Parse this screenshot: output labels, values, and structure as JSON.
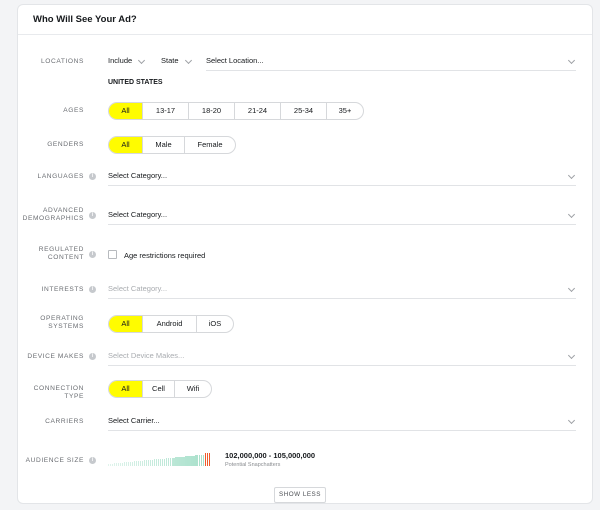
{
  "header": {
    "title": "Who Will See Your Ad?"
  },
  "locations": {
    "label": "LOCATIONS",
    "include_select": "Include",
    "type_select": "State",
    "location_placeholder": "Select Location...",
    "selected_country": "UNITED STATES"
  },
  "ages": {
    "label": "AGES",
    "options": [
      "All",
      "13-17",
      "18-20",
      "21-24",
      "25-34",
      "35+"
    ],
    "selected": "All"
  },
  "genders": {
    "label": "GENDERS",
    "options": [
      "All",
      "Male",
      "Female"
    ],
    "selected": "All"
  },
  "languages": {
    "label": "LANGUAGES",
    "value": "Select Category..."
  },
  "advanced_demographics": {
    "label_line1": "ADVANCED",
    "label_line2": "DEMOGRAPHICS",
    "value": "Select Category..."
  },
  "regulated_content": {
    "label_line1": "REGULATED",
    "label_line2": "CONTENT",
    "checkbox_label": "Age restrictions required",
    "checked": false
  },
  "interests": {
    "label": "INTERESTS",
    "placeholder": "Select Category..."
  },
  "operating_systems": {
    "label_line1": "OPERATING",
    "label_line2": "SYSTEMS",
    "options": [
      "All",
      "Android",
      "iOS"
    ],
    "selected": "All"
  },
  "device_makes": {
    "label": "DEVICE MAKES",
    "placeholder": "Select Device Makes..."
  },
  "connection_type": {
    "label": "CONNECTION TYPE",
    "options": [
      "All",
      "Cell",
      "Wifi"
    ],
    "selected": "All"
  },
  "carriers": {
    "label": "CARRIERS",
    "value": "Select Carrier..."
  },
  "audience_size": {
    "label": "AUDIENCE SIZE",
    "range": "102,000,000 - 105,000,000",
    "subtext": "Potential Snapchatters",
    "bar_color": "#a5dfc9",
    "marker_color": "#f05a2a"
  },
  "footer": {
    "show_less_label": "SHOW LESS"
  },
  "colors": {
    "accent": "#fffc00"
  }
}
